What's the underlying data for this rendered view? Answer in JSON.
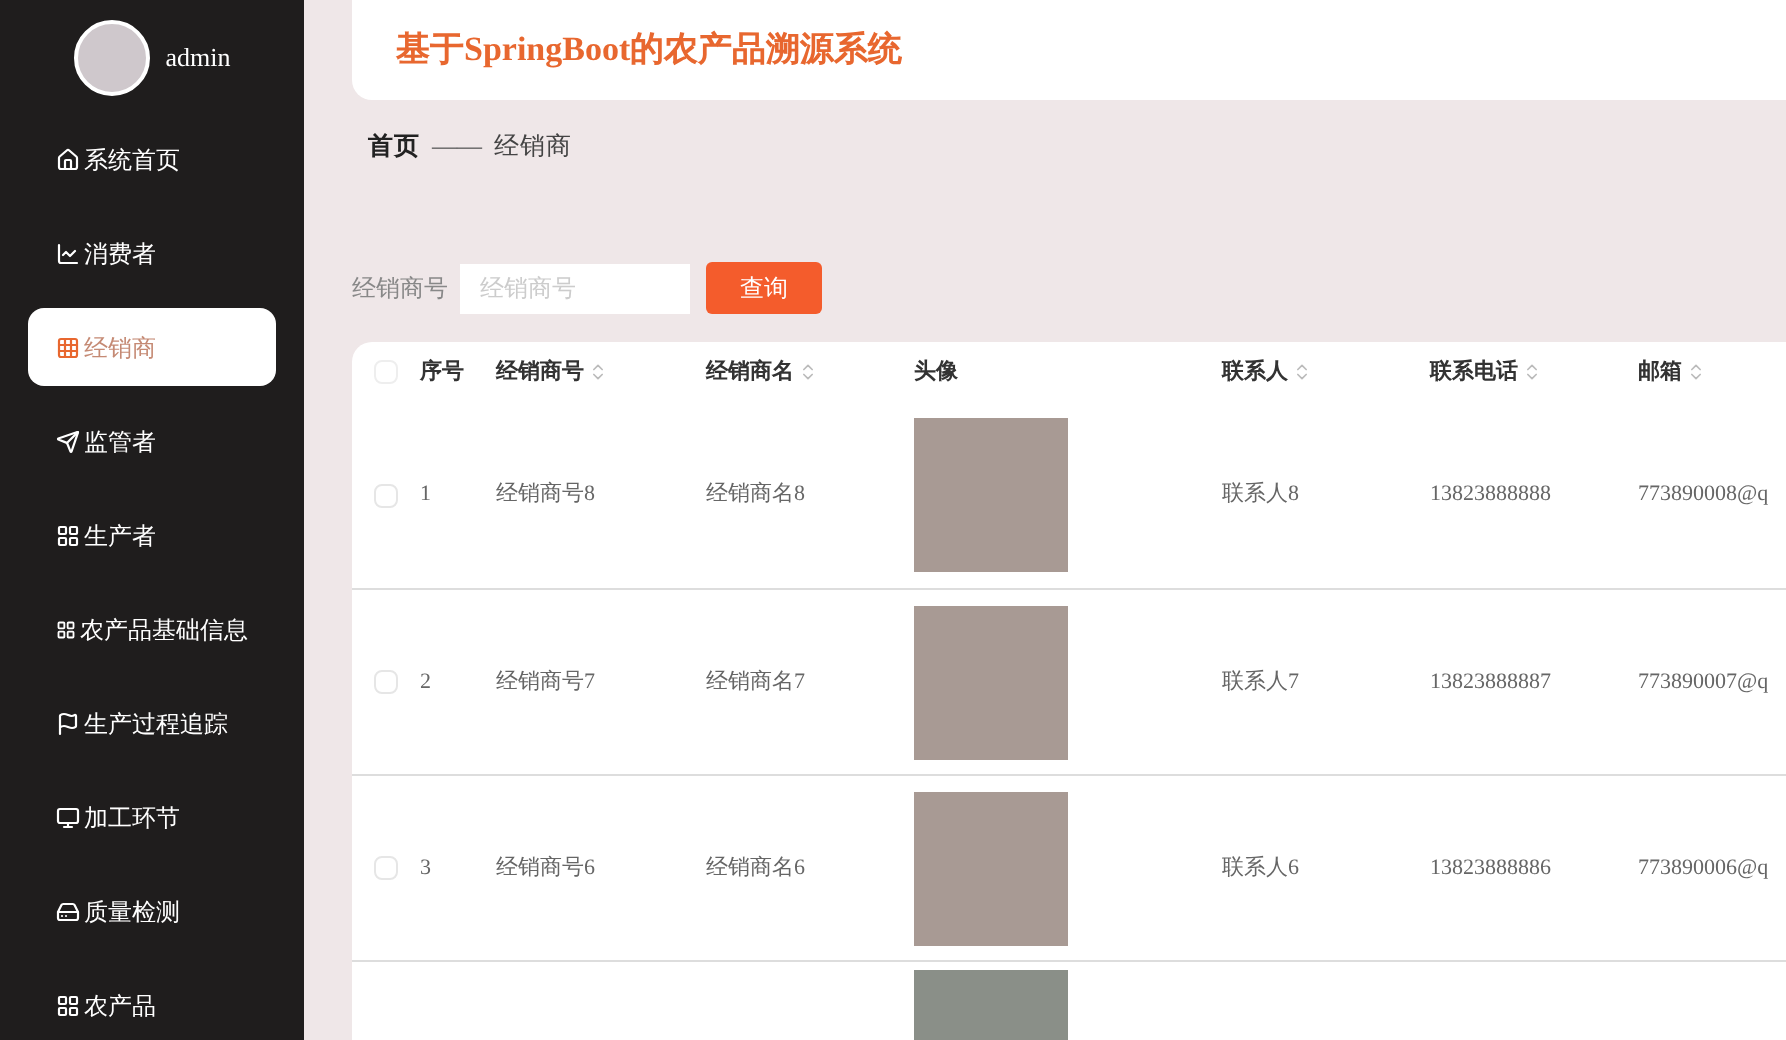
{
  "sidebar": {
    "user": "admin",
    "items": [
      {
        "label": "系统首页",
        "selected": false
      },
      {
        "label": "消费者",
        "selected": false
      },
      {
        "label": "经销商",
        "selected": true
      },
      {
        "label": "监管者",
        "selected": false
      },
      {
        "label": "生产者",
        "selected": false
      },
      {
        "label": "农产品基础信息",
        "selected": false
      },
      {
        "label": "生产过程追踪",
        "selected": false
      },
      {
        "label": "加工环节",
        "selected": false
      },
      {
        "label": "质量检测",
        "selected": false
      },
      {
        "label": "农产品",
        "selected": false
      }
    ]
  },
  "header": {
    "title": "基于SpringBoot的农产品溯源系统"
  },
  "breadcrumb": {
    "home": "首页",
    "separator": "——",
    "current": "经销商"
  },
  "search": {
    "label": "经销商号",
    "placeholder": "经销商号",
    "button": "查询"
  },
  "table": {
    "all_checked": false,
    "columns": [
      {
        "label": "序号",
        "sortable": false
      },
      {
        "label": "经销商号",
        "sortable": true
      },
      {
        "label": "经销商名",
        "sortable": true
      },
      {
        "label": "头像",
        "sortable": false
      },
      {
        "label": "联系人",
        "sortable": true
      },
      {
        "label": "联系电话",
        "sortable": true
      },
      {
        "label": "邮箱",
        "sortable": true
      }
    ],
    "rows": [
      {
        "kind": "full",
        "checked": false,
        "index": "1",
        "code": "经销商号8",
        "name": "经销商名8",
        "contact": "联系人8",
        "phone": "13823888888",
        "email": "773890008@q"
      },
      {
        "kind": "full",
        "checked": false,
        "index": "2",
        "code": "经销商号7",
        "name": "经销商名7",
        "contact": "联系人7",
        "phone": "13823888887",
        "email": "773890007@q"
      },
      {
        "kind": "full",
        "checked": false,
        "index": "3",
        "code": "经销商号6",
        "name": "经销商名6",
        "contact": "联系人6",
        "phone": "13823888886",
        "email": "773890006@q"
      },
      {
        "kind": "partial"
      }
    ]
  }
}
